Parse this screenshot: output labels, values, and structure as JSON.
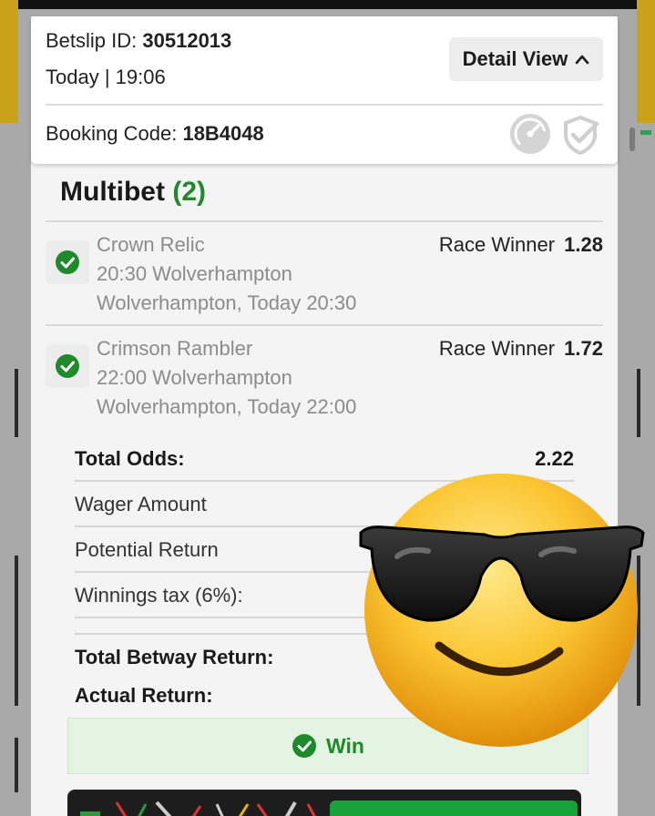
{
  "header": {
    "betslip_label": "Betslip ID:",
    "betslip_id": "30512013",
    "datetime": "Today | 19:06",
    "detail_view_label": "Detail View",
    "booking_label": "Booking Code:",
    "booking_code": "18B4048"
  },
  "multibet": {
    "title": "Multibet",
    "count": "(2)"
  },
  "legs": [
    {
      "horse": "Crown Relic",
      "race": "20:30 Wolverhampton",
      "venue_time": "Wolverhampton, Today 20:30",
      "market": "Race Winner",
      "odds": "1.28"
    },
    {
      "horse": "Crimson Rambler",
      "race": "22:00 Wolverhampton",
      "venue_time": "Wolverhampton, Today 22:00",
      "market": "Race Winner",
      "odds": "1.72"
    }
  ],
  "summary": {
    "total_odds_label": "Total Odds:",
    "total_odds_value": "2.22",
    "wager_label": "Wager Amount",
    "potential_label": "Potential Return",
    "tax_label": "Winnings tax (6%):",
    "total_return_label": "Total Betway Return:",
    "actual_return_label": "Actual Return:"
  },
  "result": {
    "label": "Win"
  },
  "colors": {
    "accent_green": "#1f8a2b",
    "win_bg": "#e3f4e2"
  },
  "icons": {
    "check": "check-circle-icon",
    "chevron": "chevron-up-icon",
    "gauge": "gauge-icon",
    "shield": "shield-check-icon",
    "emoji": "sunglasses-emoji"
  }
}
